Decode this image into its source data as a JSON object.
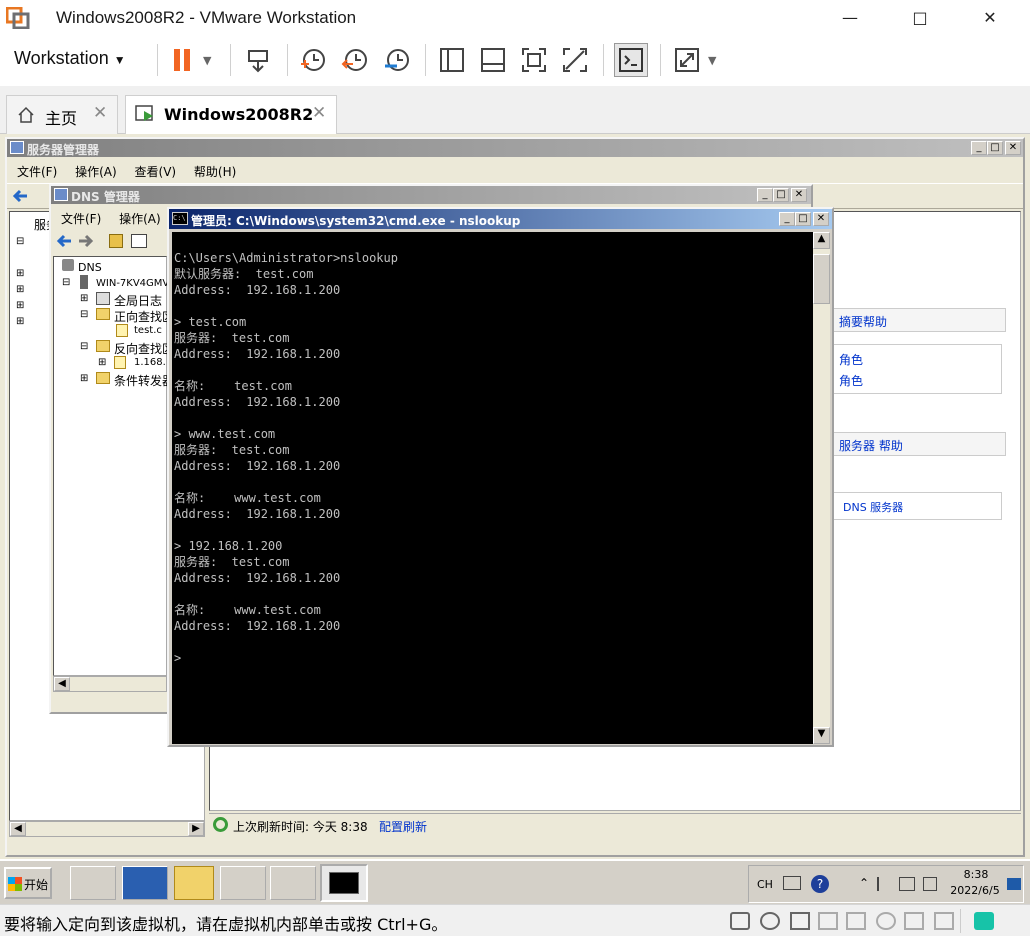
{
  "vmware": {
    "title": "Windows2008R2 - VMware Workstation",
    "menu_label": "Workstation",
    "tabs": [
      {
        "label": "主页"
      },
      {
        "label": "Windows2008R2"
      }
    ],
    "status_text": "要将输入定向到该虚拟机，请在虚拟机内部单击或按 Ctrl+G。"
  },
  "server_manager": {
    "title": "服务器管理器",
    "menu": [
      "文件(F)",
      "操作(A)",
      "查看(V)",
      "帮助(H)"
    ],
    "tree_first": "服务",
    "status_refresh": "上次刷新时间: 今天 8:38",
    "refresh_link": "配置刷新",
    "right_panel": {
      "help1": "摘要帮助",
      "roles": [
        "角色",
        "角色"
      ],
      "help2": "服务器 帮助",
      "dns_link": "DNS 服务器"
    }
  },
  "dns_manager": {
    "title": "DNS 管理器",
    "menu": [
      "文件(F)",
      "操作(A)"
    ],
    "tree": {
      "root": "DNS",
      "server": "WIN-7KV4GMVI",
      "items": [
        "全局日志",
        "正向查找区",
        "test.c",
        "反向查找区",
        "1.168.",
        "条件转发器"
      ]
    }
  },
  "cmd": {
    "title": "管理员: C:\\Windows\\system32\\cmd.exe - nslookup",
    "lines": [
      "",
      "C:\\Users\\Administrator>nslookup",
      "默认服务器:  test.com",
      "Address:  192.168.1.200",
      "",
      "> test.com",
      "服务器:  test.com",
      "Address:  192.168.1.200",
      "",
      "名称:    test.com",
      "Address:  192.168.1.200",
      "",
      "> www.test.com",
      "服务器:  test.com",
      "Address:  192.168.1.200",
      "",
      "名称:    www.test.com",
      "Address:  192.168.1.200",
      "",
      "> 192.168.1.200",
      "服务器:  test.com",
      "Address:  192.168.1.200",
      "",
      "名称:    www.test.com",
      "Address:  192.168.1.200",
      "",
      ">"
    ]
  },
  "taskbar": {
    "start": "开始",
    "lang": "CH",
    "time": "8:38",
    "date": "2022/6/5"
  },
  "colors": {
    "pause": "#f26522",
    "accent": "#0a246a"
  }
}
